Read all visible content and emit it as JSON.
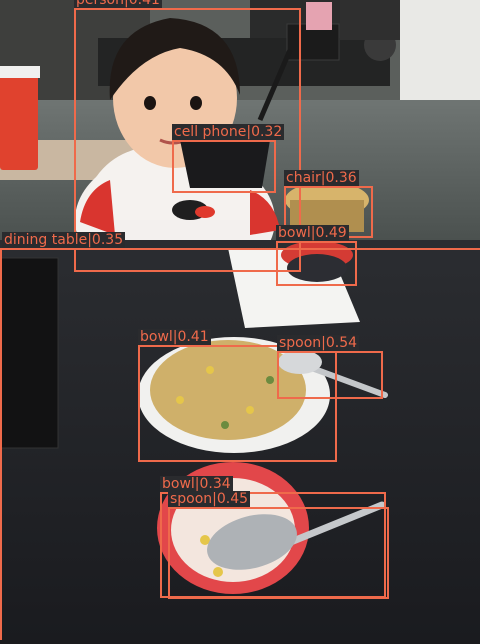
{
  "scene": {
    "description": "Detection overlay on a restaurant photo with a toddler at a table.",
    "box_color": "#ef6a4b",
    "label_bg": "#2a2b2e"
  },
  "detections": [
    {
      "class": "person",
      "score": "0.41",
      "label": "person|0.41"
    },
    {
      "class": "cell phone",
      "score": "0.32",
      "label": "cell phone|0.32"
    },
    {
      "class": "chair",
      "score": "0.36",
      "label": "chair|0.36"
    },
    {
      "class": "dining table",
      "score": "0.35",
      "label": "dining table|0.35"
    },
    {
      "class": "bowl",
      "score": "0.49",
      "label": "bowl|0.49"
    },
    {
      "class": "bowl",
      "score": "0.41",
      "label": "bowl|0.41"
    },
    {
      "class": "spoon",
      "score": "0.54",
      "label": "spoon|0.54"
    },
    {
      "class": "bowl",
      "score": "0.34",
      "label": "bowl|0.34"
    },
    {
      "class": "spoon",
      "score": "0.45",
      "label": "spoon|0.45"
    }
  ]
}
